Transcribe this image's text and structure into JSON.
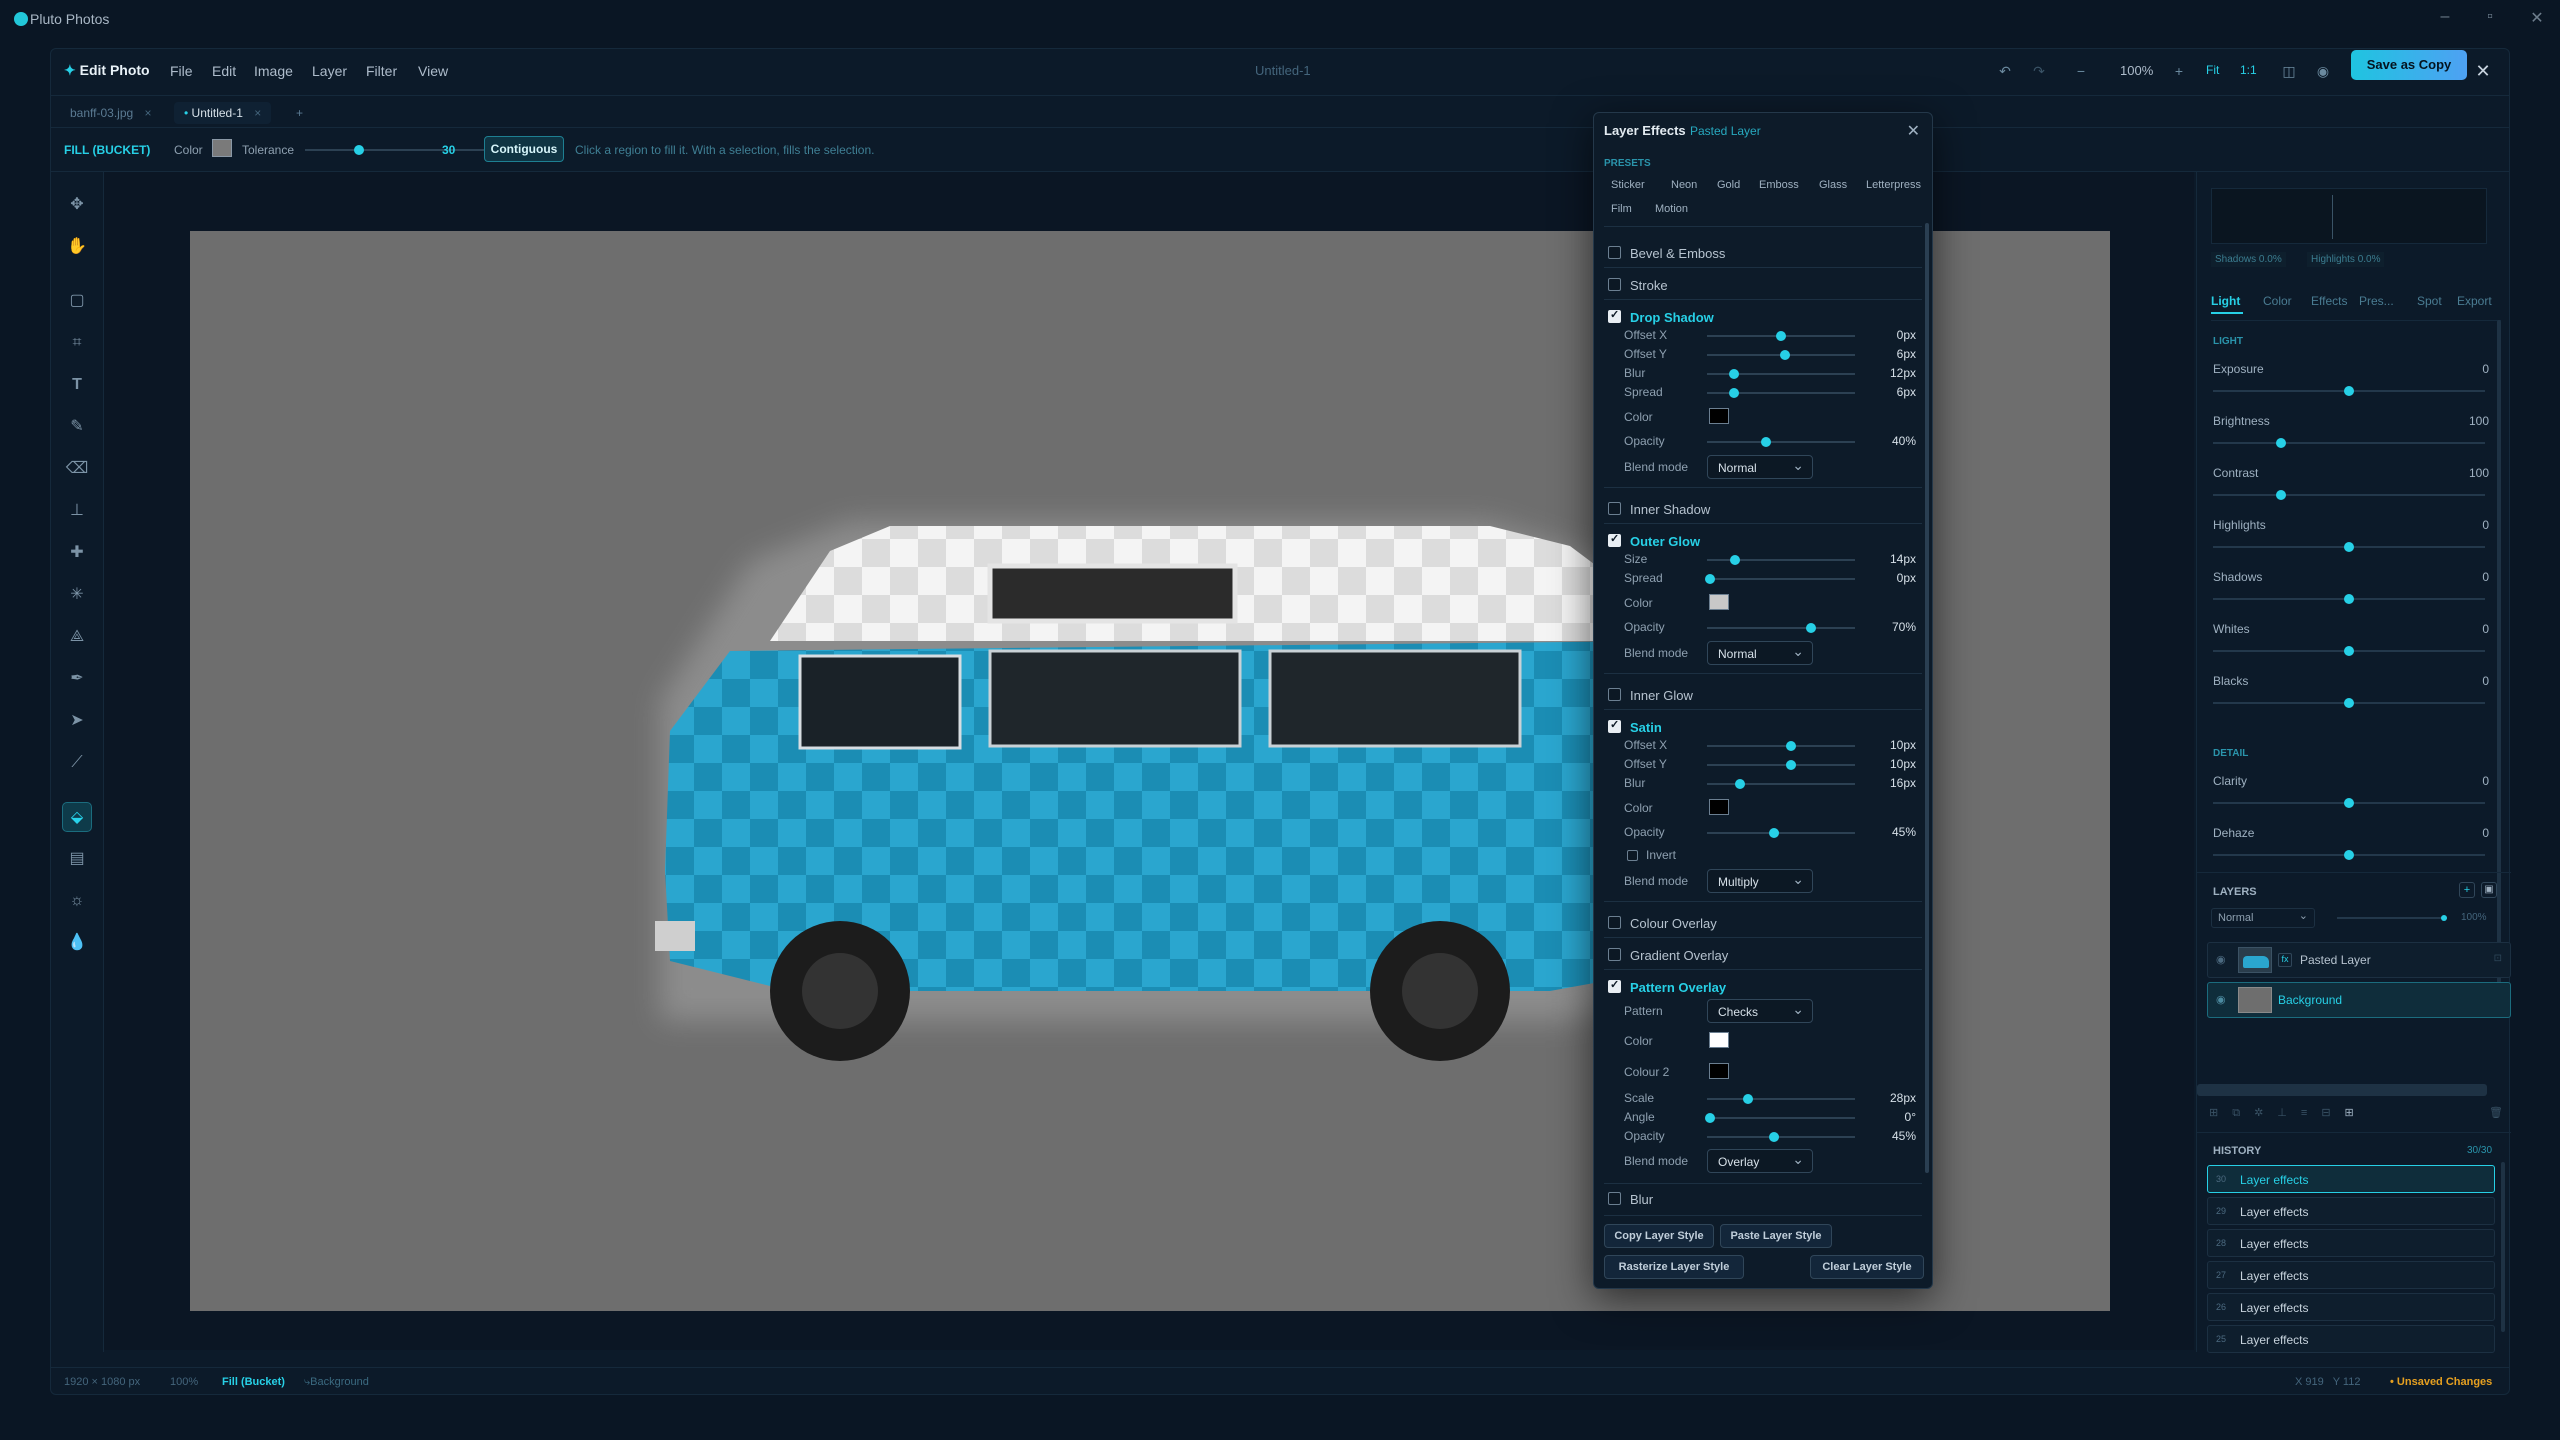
{
  "app": {
    "title": "Pluto Photos"
  },
  "menubar": {
    "brand": "Edit Photo",
    "menus": [
      "File",
      "Edit",
      "Image",
      "Layer",
      "Filter",
      "View"
    ],
    "doc_title": "Untitled-1",
    "zoom": "100%",
    "fit": "Fit",
    "one_to_one": "1:1",
    "save_copy": "Save as Copy"
  },
  "tabs": [
    {
      "label": "banff-03.jpg"
    },
    {
      "label": "Untitled-1"
    }
  ],
  "options": {
    "tool_name": "FILL (BUCKET)",
    "color_label": "Color",
    "tolerance_label": "Tolerance",
    "tolerance_value": "30",
    "tolerance_fraction": 0.3,
    "contiguous_label": "Contiguous",
    "hint": "Click a region to fill it. With a selection, fills the selection."
  },
  "layer_effects": {
    "title": "Layer Effects",
    "subtitle": "Pasted Layer",
    "presets_label": "PRESETS",
    "presets_row1": [
      "Sticker",
      "Neon",
      "Gold",
      "Emboss",
      "Glass",
      "Letterpress"
    ],
    "presets_row2": [
      "Film",
      "Motion"
    ],
    "bevel": "Bevel & Emboss",
    "stroke": "Stroke",
    "drop_shadow": {
      "label": "Drop Shadow",
      "offset_x": {
        "label": "Offset X",
        "value": "0px",
        "pos": 0.5
      },
      "offset_y": {
        "label": "Offset Y",
        "value": "6px",
        "pos": 0.53
      },
      "blur": {
        "label": "Blur",
        "value": "12px",
        "pos": 0.18
      },
      "spread": {
        "label": "Spread",
        "value": "6px",
        "pos": 0.18
      },
      "color_label": "Color",
      "color": "#000000",
      "opacity": {
        "label": "Opacity",
        "value": "40%",
        "pos": 0.4
      },
      "blend_label": "Blend mode",
      "blend": "Normal"
    },
    "inner_shadow": "Inner Shadow",
    "outer_glow": {
      "label": "Outer Glow",
      "size": {
        "label": "Size",
        "value": "14px",
        "pos": 0.19
      },
      "spread": {
        "label": "Spread",
        "value": "0px",
        "pos": 0.02
      },
      "color_label": "Color",
      "color": "#c8c8c8",
      "opacity": {
        "label": "Opacity",
        "value": "70%",
        "pos": 0.7
      },
      "blend_label": "Blend mode",
      "blend": "Normal"
    },
    "inner_glow": "Inner Glow",
    "satin": {
      "label": "Satin",
      "offset_x": {
        "label": "Offset X",
        "value": "10px",
        "pos": 0.57
      },
      "offset_y": {
        "label": "Offset Y",
        "value": "10px",
        "pos": 0.57
      },
      "blur": {
        "label": "Blur",
        "value": "16px",
        "pos": 0.22
      },
      "color_label": "Color",
      "color": "#000000",
      "opacity": {
        "label": "Opacity",
        "value": "45%",
        "pos": 0.45
      },
      "invert": "Invert",
      "blend_label": "Blend mode",
      "blend": "Multiply"
    },
    "colour_overlay": "Colour Overlay",
    "gradient_overlay": "Gradient Overlay",
    "pattern_overlay": {
      "label": "Pattern Overlay",
      "pattern_label": "Pattern",
      "pattern": "Checks",
      "color_label": "Color",
      "color": "#ffffff",
      "color2_label": "Colour 2",
      "color2": "#000000",
      "scale": {
        "label": "Scale",
        "value": "28px",
        "pos": 0.28
      },
      "angle": {
        "label": "Angle",
        "value": "0°",
        "pos": 0.02
      },
      "opacity": {
        "label": "Opacity",
        "value": "45%",
        "pos": 0.45
      },
      "blend_label": "Blend mode",
      "blend": "Overlay"
    },
    "blur": "Blur",
    "copy_style": "Copy Layer Style",
    "paste_style": "Paste Layer Style",
    "rasterize_style": "Rasterize Layer Style",
    "clear_style": "Clear Layer Style"
  },
  "right": {
    "shadows_stat": "Shadows 0.0%",
    "highlights_stat": "Highlights 0.0%",
    "tabs": [
      "Light",
      "Color",
      "Effects",
      "Pres...",
      "Spot",
      "Export"
    ],
    "light_header": "LIGHT",
    "adjustments": [
      {
        "label": "Exposure",
        "value": "0",
        "pos": 0.5
      },
      {
        "label": "Brightness",
        "value": "100",
        "pos": 0.25
      },
      {
        "label": "Contrast",
        "value": "100",
        "pos": 0.25
      },
      {
        "label": "Highlights",
        "value": "0",
        "pos": 0.5
      },
      {
        "label": "Shadows",
        "value": "0",
        "pos": 0.5
      },
      {
        "label": "Whites",
        "value": "0",
        "pos": 0.5
      },
      {
        "label": "Blacks",
        "value": "0",
        "pos": 0.5
      }
    ],
    "detail_header": "DETAIL",
    "detail": [
      {
        "label": "Clarity",
        "value": "0",
        "pos": 0.5
      },
      {
        "label": "Dehaze",
        "value": "0",
        "pos": 0.5
      }
    ],
    "layers_header": "LAYERS",
    "blend_mode": "Normal",
    "layer_opacity": "100%",
    "layers": [
      {
        "name": "Pasted Layer",
        "fx": "fx"
      },
      {
        "name": "Background"
      }
    ],
    "history_header": "HISTORY",
    "history_count": "30/30",
    "history": [
      {
        "num": "30",
        "label": "Layer effects"
      },
      {
        "num": "29",
        "label": "Layer effects"
      },
      {
        "num": "28",
        "label": "Layer effects"
      },
      {
        "num": "27",
        "label": "Layer effects"
      },
      {
        "num": "26",
        "label": "Layer effects"
      },
      {
        "num": "25",
        "label": "Layer effects"
      }
    ]
  },
  "status": {
    "dimensions": "1920 × 1080 px",
    "zoom": "100%",
    "tool": "Fill (Bucket)",
    "layer": "Background",
    "coords": "X 919   Y 112",
    "unsaved": "Unsaved Changes"
  }
}
